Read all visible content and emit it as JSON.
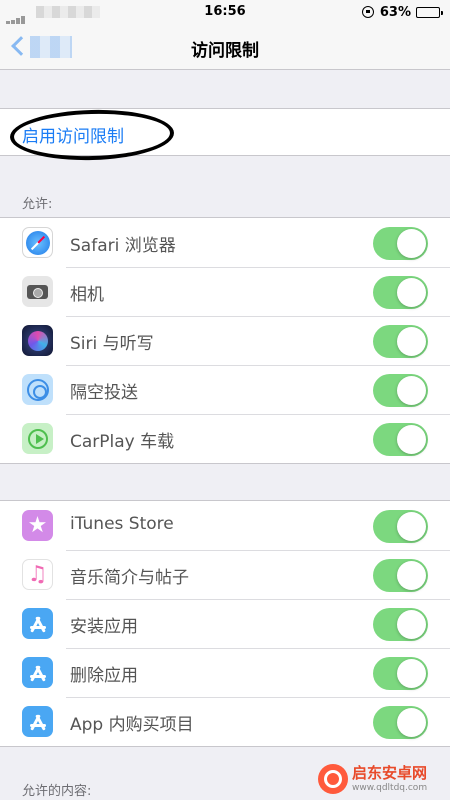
{
  "status_bar": {
    "time": "16:56",
    "battery_text": "63%",
    "battery_level": 0.63
  },
  "nav": {
    "title": "访问限制"
  },
  "enable": {
    "label": "启用访问限制"
  },
  "allow_section": {
    "header": "允许:",
    "items": [
      {
        "label": "Safari 浏览器",
        "icon": "safari-icon",
        "on": true
      },
      {
        "label": "相机",
        "icon": "camera-icon",
        "on": true
      },
      {
        "label": "Siri 与听写",
        "icon": "siri-icon",
        "on": true
      },
      {
        "label": "隔空投送",
        "icon": "airdrop-icon",
        "on": true
      },
      {
        "label": "CarPlay 车载",
        "icon": "carplay-icon",
        "on": true
      }
    ]
  },
  "store_section": {
    "items": [
      {
        "label": "iTunes Store",
        "icon": "itunes-star-icon",
        "on": true
      },
      {
        "label": "音乐简介与帖子",
        "icon": "music-note-icon",
        "on": true
      },
      {
        "label": "安装应用",
        "icon": "app-store-icon",
        "on": true
      },
      {
        "label": "删除应用",
        "icon": "app-store-icon",
        "on": true
      },
      {
        "label": "App 内购买项目",
        "icon": "app-store-icon",
        "on": true
      }
    ]
  },
  "allowed_content_header": "允许的内容:",
  "watermark": {
    "name": "启东安卓网",
    "url": "www.qdltdq.com"
  },
  "colors": {
    "toggle_on": "#7cd87f",
    "link": "#1a7cf5",
    "background": "#efeff4"
  }
}
